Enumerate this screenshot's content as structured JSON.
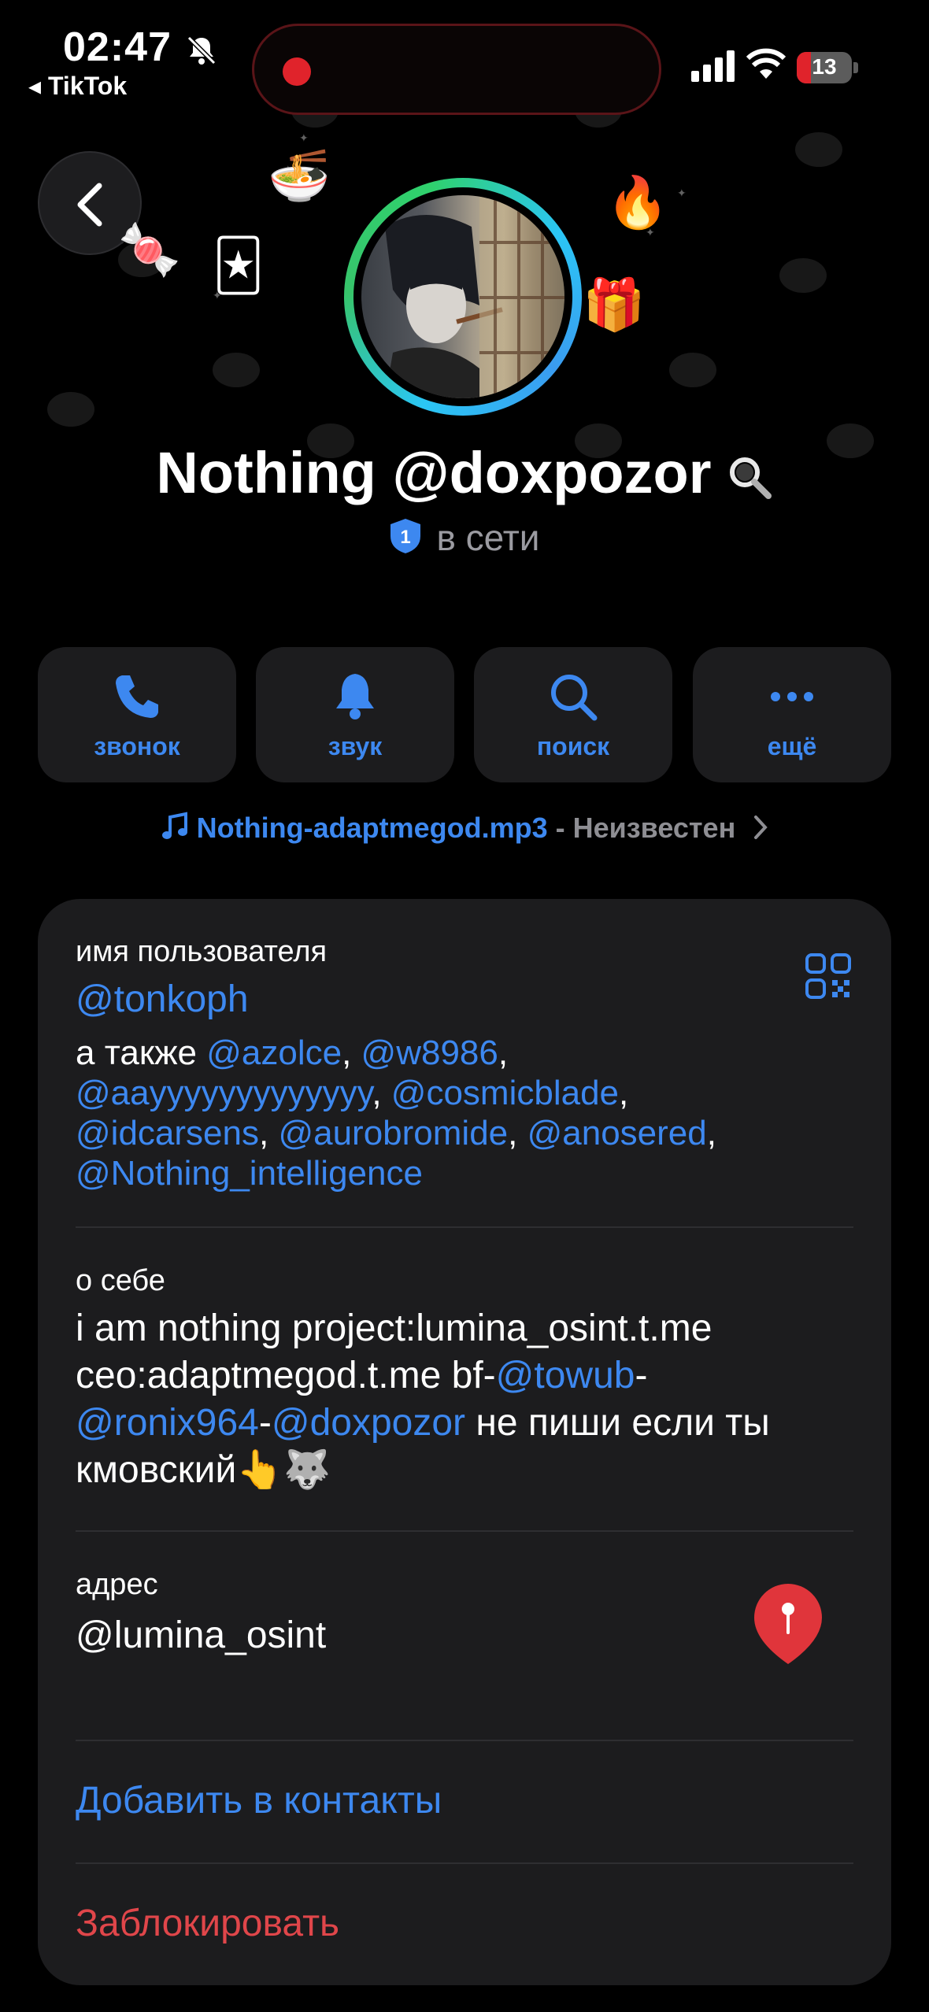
{
  "status_bar": {
    "time": "02:47",
    "back_app": "◂ TikTok",
    "battery": "13"
  },
  "profile": {
    "name": "Nothing @doxpozor",
    "badge": "1",
    "status": "в сети"
  },
  "actions": [
    {
      "label": "звонок",
      "icon": "phone-icon"
    },
    {
      "label": "звук",
      "icon": "bell-icon"
    },
    {
      "label": "поиск",
      "icon": "search-icon"
    },
    {
      "label": "ещё",
      "icon": "more-icon"
    }
  ],
  "music": {
    "file": "Nothing-adaptmegod.mp3",
    "separator": " - ",
    "artist": "Неизвестен"
  },
  "info": {
    "username_label": "имя пользователя",
    "username": "@tonkoph",
    "also_prefix": "а также",
    "also": [
      "@azolce",
      "@w8986",
      "@aayyyyyyyyyyyyy",
      "@cosmicblade",
      "@idcarsens",
      "@aurobromide",
      "@anosered",
      "@Nothing_intelligence"
    ],
    "bio_label": "о себе",
    "bio_line1": "i am nothing project:lumina_osint.t.me",
    "bio_line2": "ceo:adaptmegod.t.me bf-",
    "bio_link1": "@towub",
    "bio_dash": "-",
    "bio_link2": "@ronix964",
    "bio_link3": "@doxpozor",
    "bio_tail": " не пиши если ты",
    "bio_line4": "кмовский",
    "bio_emoji": "👆🐺",
    "address_label": "адрес",
    "address": "@lumina_osint",
    "add_contact": "Добавить в контакты",
    "block": "Заблокировать"
  },
  "colors": {
    "accent": "#3d88f0",
    "danger": "#e0464a",
    "card": "#1c1c1e"
  }
}
